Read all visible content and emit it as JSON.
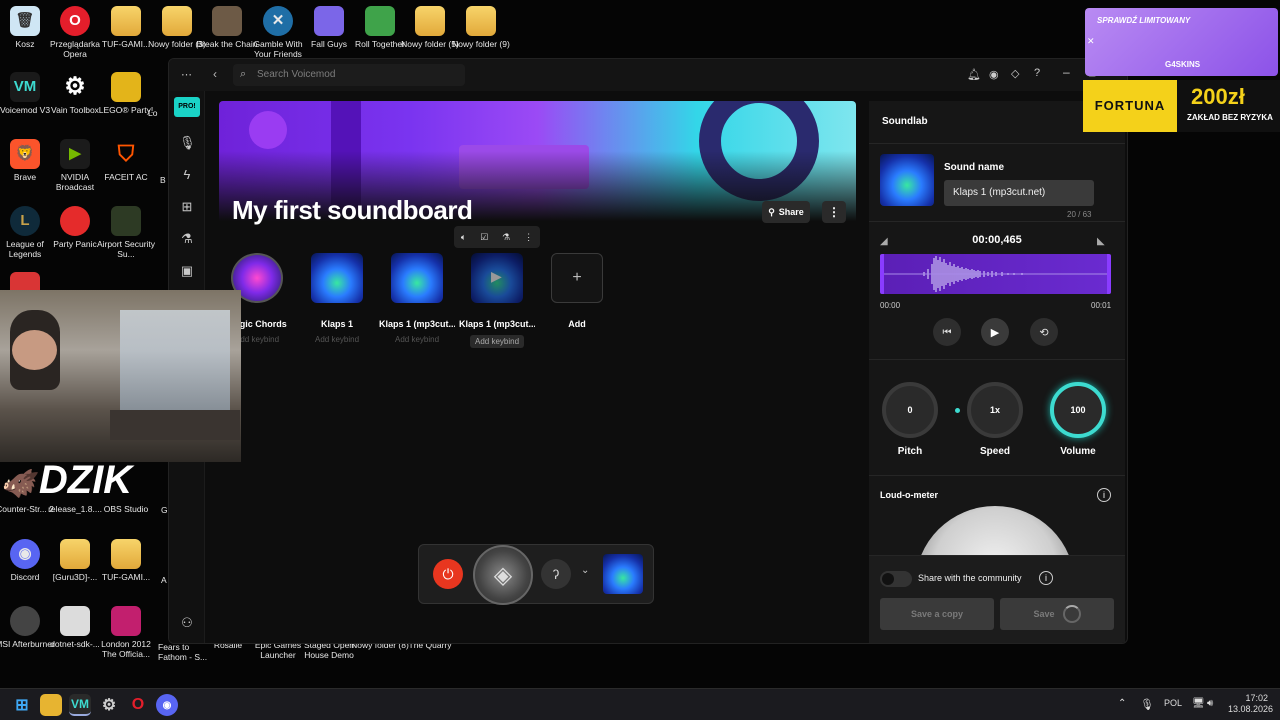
{
  "desktop": {
    "icons_row1": [
      "Kosz",
      "Przeglądarka Opera",
      "TUF-GAMI...",
      "Nowy folder (3)",
      "Break the Chain",
      "Gamble With Your Friends",
      "Fall Guys",
      "Roll Together",
      "Nowy folder (5)",
      "Nowy folder (9)"
    ],
    "icons_col1": [
      "Voicemod V3",
      "Brave",
      "League of Legends",
      "Counter-Str... 2",
      "Discord",
      "MSI Afterburner"
    ],
    "icons_col2": [
      "Vain Toolbox",
      "NVIDIA Broadcast",
      "Party Panic",
      "release_1.8....",
      "[Guru3D]-...",
      "dotnet-sdk-..."
    ],
    "icons_col3": [
      "LEGO® Party!",
      "FACEIT AC",
      "Airport Security Su...",
      "OBS Studio",
      "TUF-GAMI...",
      "London 2012 The Officia..."
    ],
    "icons_bottom": [
      "Fears to Fathom - S...",
      "Rosalie",
      "Epic Games Launcher",
      "Staged Open House Demo",
      "Nowy folder (8)",
      "The Quarry"
    ],
    "partial_labels": [
      "Lo",
      "B",
      "G",
      "A",
      "Lo"
    ]
  },
  "app": {
    "search_placeholder": "Search Voicemod",
    "pro_badge": "PRO!",
    "soundboard_title": "My first soundboard",
    "share_label": "Share",
    "sounds": [
      {
        "name": "Magic Chords",
        "keybind": "Add keybind"
      },
      {
        "name": "Klaps 1",
        "keybind": "Add keybind"
      },
      {
        "name": "Klaps 1 (mp3cut...",
        "keybind": "Add keybind"
      },
      {
        "name": "Klaps 1 (mp3cut...",
        "keybind": "Add keybind"
      },
      {
        "name": "Add",
        "keybind": ""
      }
    ]
  },
  "soundlab": {
    "title": "Soundlab",
    "sound_name_label": "Sound name",
    "sound_name_value": "Klaps 1 (mp3cut.net)",
    "char_count": "20 / 63",
    "time_current": "00:00,465",
    "time_start": "00:00",
    "time_end": "00:01",
    "pitch_value": "0",
    "pitch_label": "Pitch",
    "speed_value": "1x",
    "speed_label": "Speed",
    "volume_value": "100",
    "volume_label": "Volume",
    "loudometer_label": "Loud-o-meter",
    "share_community_label": "Share with the community",
    "save_copy_label": "Save a copy",
    "save_label": "Save"
  },
  "ads": {
    "ad1_text": "SPRAWDŹ LIMITOWANY",
    "ad1_brand": "G4SKINS",
    "ad2_brand": "FORTUNA",
    "ad2_amount": "200zł",
    "ad2_sub": "ZAKŁAD BEZ RYZYKA"
  },
  "overlay": {
    "brand": "DZIK"
  },
  "taskbar": {
    "language": "POL",
    "time": "17:02",
    "date": "13.08.2026"
  },
  "colors": {
    "accent": "#7a2de0",
    "teal": "#3ddbd0",
    "red": "#e8361f"
  }
}
